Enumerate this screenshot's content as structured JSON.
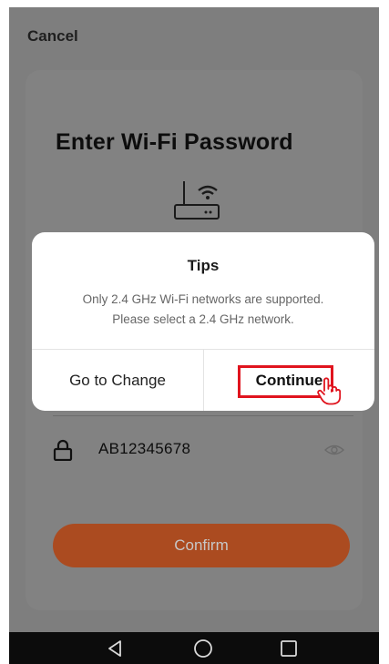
{
  "header": {
    "cancel_label": "Cancel"
  },
  "page": {
    "title": "Enter Wi-Fi Password"
  },
  "password": {
    "value": "AB12345678"
  },
  "confirm": {
    "label": "Confirm"
  },
  "dialog": {
    "title": "Tips",
    "message_line1": "Only 2.4 GHz Wi-Fi networks are supported.",
    "message_line2": "Please select a 2.4 GHz network.",
    "go_to_change_label": "Go to Change",
    "continue_label": "Continue"
  },
  "icons": {
    "router": "router-wifi-icon",
    "lock": "lock-icon",
    "eye": "eye-icon",
    "back": "back-triangle-icon",
    "home": "home-circle-icon",
    "recents": "recents-square-icon",
    "hand": "pointing-hand-icon"
  },
  "colors": {
    "accent": "#ab4b20",
    "highlight": "#e0141e",
    "overlay": "#7e7e7e",
    "dialog_bg": "#ffffff"
  }
}
